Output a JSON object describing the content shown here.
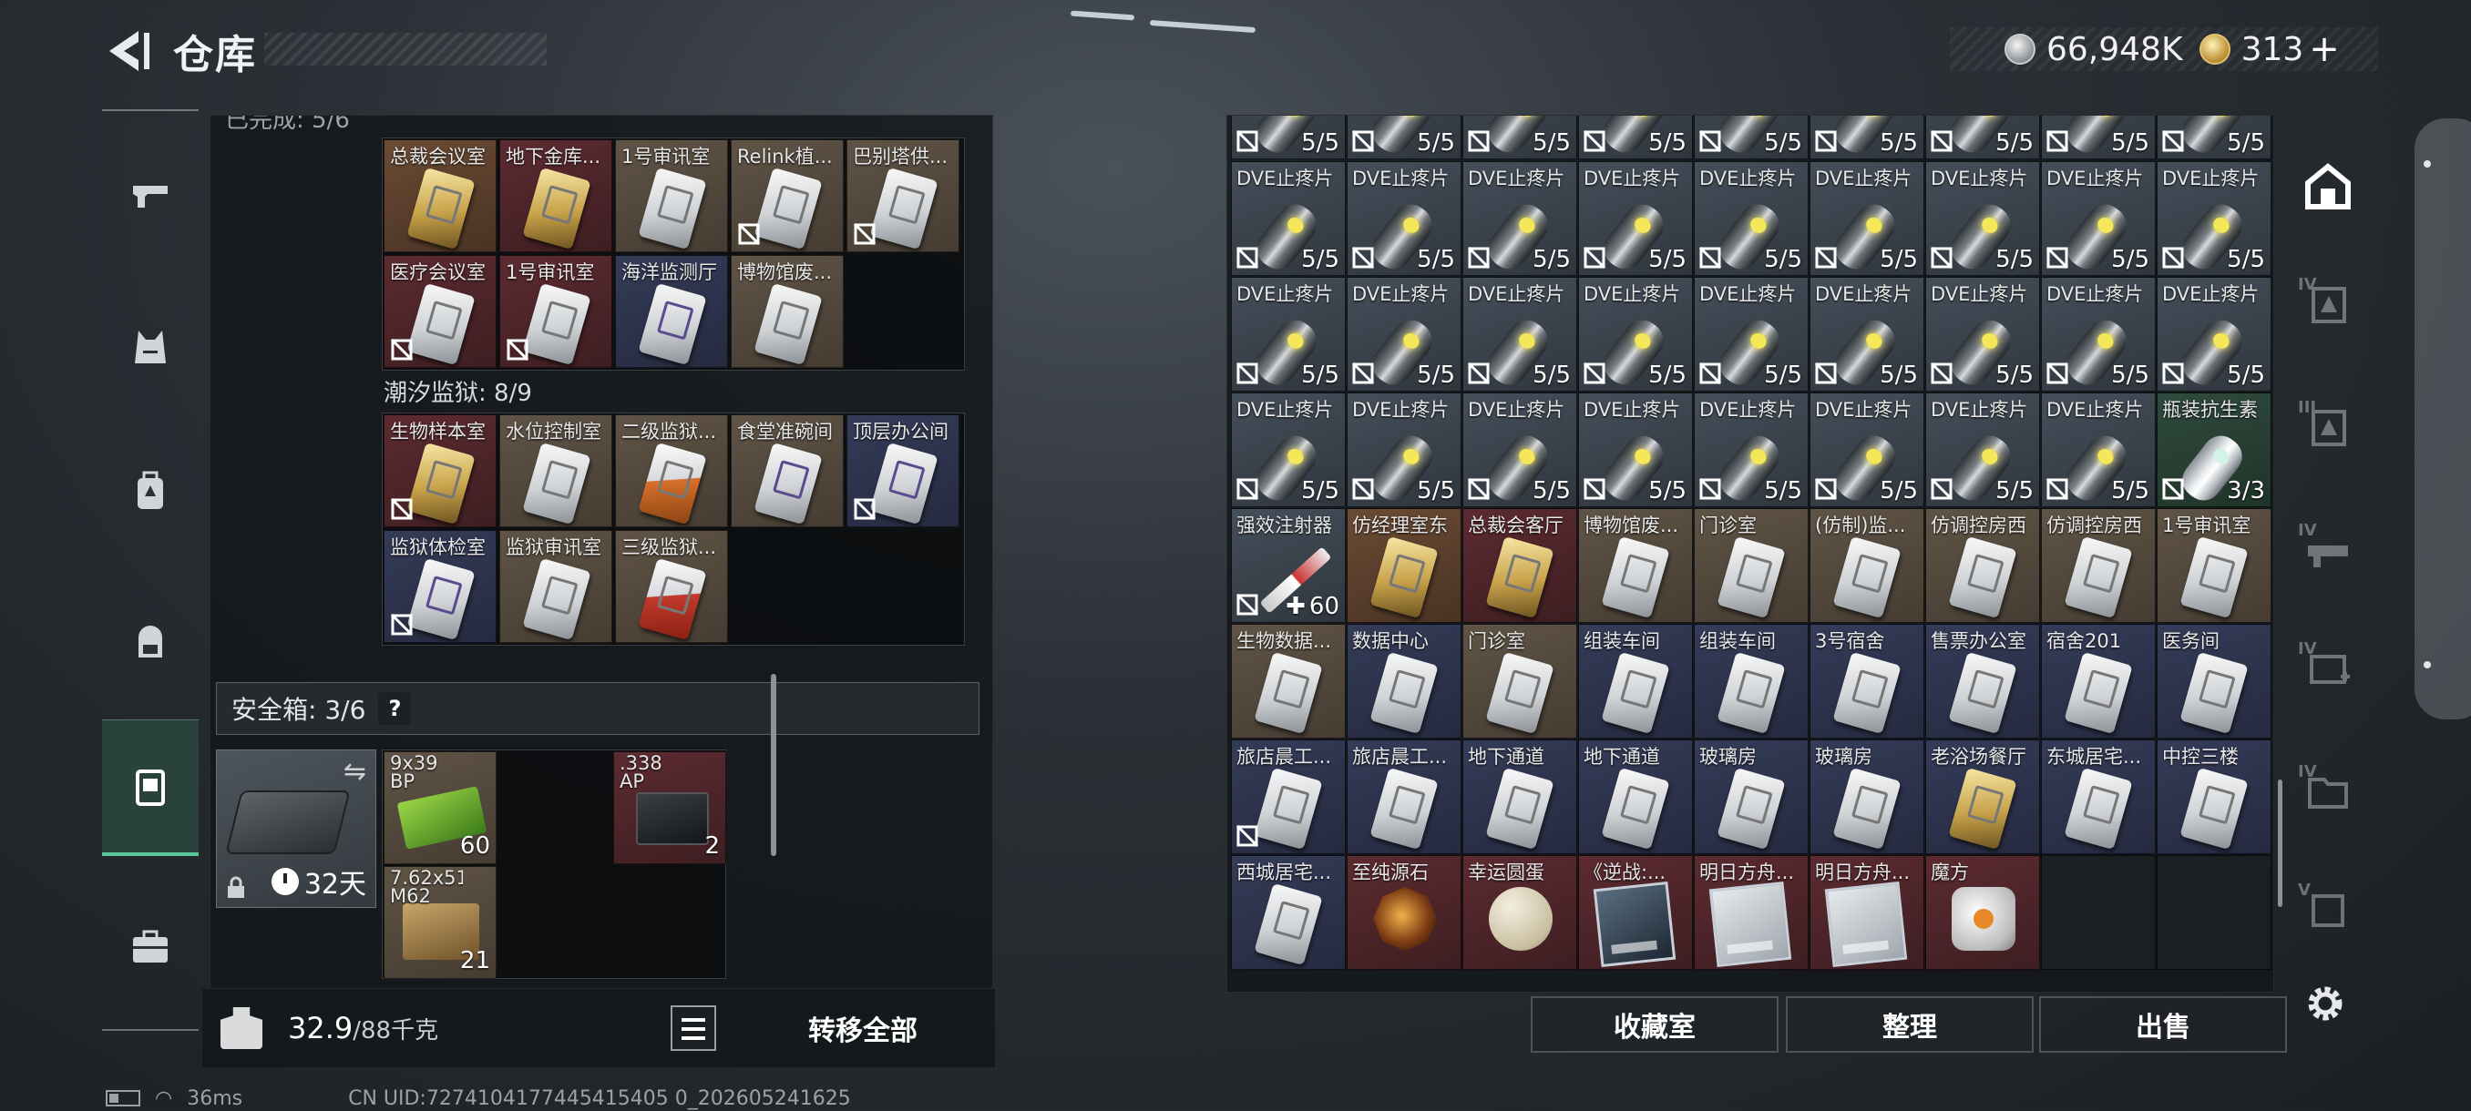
{
  "header": {
    "title": "仓库",
    "currency_silver": "66,948K",
    "currency_gold": "313",
    "plus": "+"
  },
  "left_panel": {
    "top_cut_label": "已完成: 5/6",
    "group1_cards": [
      {
        "name": "总裁会议室",
        "color": "gold",
        "card": "gold",
        "locked": false
      },
      {
        "name": "地下金库...",
        "color": "red",
        "card": "gold",
        "locked": false
      },
      {
        "name": "1号审讯室",
        "color": "brown",
        "card": "white",
        "locked": false
      },
      {
        "name": "Relink植...",
        "color": "brown",
        "card": "white",
        "locked": true
      },
      {
        "name": "巴别塔供...",
        "color": "brown",
        "card": "white",
        "locked": true
      },
      {
        "name": "医疗会议室",
        "color": "red",
        "card": "white",
        "locked": true
      },
      {
        "name": "1号审讯室",
        "color": "red",
        "card": "white",
        "locked": true
      },
      {
        "name": "海洋监测厅",
        "color": "blue",
        "card": "purple",
        "locked": false
      },
      {
        "name": "博物馆废...",
        "color": "brown",
        "card": "white",
        "locked": false
      }
    ],
    "prison_label": "潮汐监狱: 8/9",
    "group2_cards": [
      {
        "name": "生物样本室",
        "color": "red",
        "card": "gold",
        "locked": true
      },
      {
        "name": "水位控制室",
        "color": "brown",
        "card": "white",
        "locked": false
      },
      {
        "name": "二级监狱...",
        "color": "brown",
        "card": "orange",
        "locked": false
      },
      {
        "name": "食堂准碗间",
        "color": "brown",
        "card": "purple",
        "locked": false
      },
      {
        "name": "顶层办公间",
        "color": "blue",
        "card": "purple",
        "locked": true
      },
      {
        "name": "监狱体检室",
        "color": "blue",
        "card": "purple",
        "locked": true
      },
      {
        "name": "监狱审讯室",
        "color": "brown",
        "card": "white",
        "locked": false
      },
      {
        "name": "三级监狱...",
        "color": "brown",
        "card": "red",
        "locked": false
      }
    ],
    "safebox_label": "安全箱: 3/6",
    "help": "?",
    "safebox_days": "32天",
    "swap": "⇋",
    "ammo": [
      {
        "name": "9x39 BP",
        "qty": "60",
        "color": "brown"
      },
      {
        "name": ".338 AP",
        "qty": "2",
        "color": "red"
      },
      {
        "name": "7.62x51 M62",
        "qty": "21",
        "color": "brown"
      }
    ],
    "weight_current": "32.9",
    "weight_max": "/88千克",
    "transfer_all": "转移全部"
  },
  "inventory": {
    "pill_name": "DVE止疼片",
    "antibiotic_name": "瓶装抗生素",
    "injector_name": "强效注射器",
    "row0_qty": "5/5",
    "rows": [
      {
        "cells": [
          {
            "n": "",
            "q": "5/5",
            "k": "pill"
          },
          {
            "n": "",
            "q": "5/5",
            "k": "pill"
          },
          {
            "n": "",
            "q": "5/5",
            "k": "pill"
          },
          {
            "n": "",
            "q": "5/5",
            "k": "pill"
          },
          {
            "n": "",
            "q": "5/5",
            "k": "pill"
          },
          {
            "n": "",
            "q": "5/5",
            "k": "pill"
          },
          {
            "n": "",
            "q": "5/5",
            "k": "pill"
          },
          {
            "n": "",
            "q": "5/5",
            "k": "pill"
          },
          {
            "n": "",
            "q": "5/5",
            "k": "pill"
          }
        ]
      },
      {
        "cells": [
          {
            "n": "DVE止疼片",
            "q": "5/5",
            "k": "pill"
          },
          {
            "n": "DVE止疼片",
            "q": "5/5",
            "k": "pill"
          },
          {
            "n": "DVE止疼片",
            "q": "5/5",
            "k": "pill"
          },
          {
            "n": "DVE止疼片",
            "q": "5/5",
            "k": "pill"
          },
          {
            "n": "DVE止疼片",
            "q": "5/5",
            "k": "pill"
          },
          {
            "n": "DVE止疼片",
            "q": "5/5",
            "k": "pill"
          },
          {
            "n": "DVE止疼片",
            "q": "5/5",
            "k": "pill"
          },
          {
            "n": "DVE止疼片",
            "q": "5/5",
            "k": "pill"
          },
          {
            "n": "DVE止疼片",
            "q": "5/5",
            "k": "pill"
          }
        ]
      },
      {
        "cells": [
          {
            "n": "DVE止疼片",
            "q": "5/5",
            "k": "pill"
          },
          {
            "n": "DVE止疼片",
            "q": "5/5",
            "k": "pill"
          },
          {
            "n": "DVE止疼片",
            "q": "5/5",
            "k": "pill"
          },
          {
            "n": "DVE止疼片",
            "q": "5/5",
            "k": "pill"
          },
          {
            "n": "DVE止疼片",
            "q": "5/5",
            "k": "pill"
          },
          {
            "n": "DVE止疼片",
            "q": "5/5",
            "k": "pill"
          },
          {
            "n": "DVE止疼片",
            "q": "5/5",
            "k": "pill"
          },
          {
            "n": "DVE止疼片",
            "q": "5/5",
            "k": "pill"
          },
          {
            "n": "DVE止疼片",
            "q": "5/5",
            "k": "pill"
          }
        ]
      },
      {
        "cells": [
          {
            "n": "DVE止疼片",
            "q": "5/5",
            "k": "pill"
          },
          {
            "n": "DVE止疼片",
            "q": "5/5",
            "k": "pill"
          },
          {
            "n": "DVE止疼片",
            "q": "5/5",
            "k": "pill"
          },
          {
            "n": "DVE止疼片",
            "q": "5/5",
            "k": "pill"
          },
          {
            "n": "DVE止疼片",
            "q": "5/5",
            "k": "pill"
          },
          {
            "n": "DVE止疼片",
            "q": "5/5",
            "k": "pill"
          },
          {
            "n": "DVE止疼片",
            "q": "5/5",
            "k": "pill"
          },
          {
            "n": "DVE止疼片",
            "q": "5/5",
            "k": "pill"
          },
          {
            "n": "瓶装抗生素",
            "q": "3/3",
            "k": "pill-white",
            "bg": "green"
          }
        ]
      },
      {
        "cells": [
          {
            "n": "强效注射器",
            "q": "60",
            "k": "syringe",
            "bg": "pill",
            "plus": true
          },
          {
            "n": "仿经理室东",
            "q": "",
            "k": "card-gold",
            "bg": "gold"
          },
          {
            "n": "总裁会客厅",
            "q": "",
            "k": "card-gold",
            "bg": "red"
          },
          {
            "n": "博物馆废...",
            "q": "",
            "k": "card-white",
            "bg": "brown"
          },
          {
            "n": "门诊室",
            "q": "",
            "k": "card-white",
            "bg": "brown"
          },
          {
            "n": "(仿制)监...",
            "q": "",
            "k": "card-white",
            "bg": "brown"
          },
          {
            "n": "仿调控房西",
            "q": "",
            "k": "card-white",
            "bg": "brown"
          },
          {
            "n": "仿调控房西",
            "q": "",
            "k": "card-white",
            "bg": "brown"
          },
          {
            "n": "1号审讯室",
            "q": "",
            "k": "card-white",
            "bg": "brown"
          }
        ]
      },
      {
        "cells": [
          {
            "n": "生物数据...",
            "q": "",
            "k": "card-white",
            "bg": "brown"
          },
          {
            "n": "数据中心",
            "q": "",
            "k": "card-white",
            "bg": "blue"
          },
          {
            "n": "门诊室",
            "q": "",
            "k": "card-white",
            "bg": "brown"
          },
          {
            "n": "组装车间",
            "q": "",
            "k": "card-white",
            "bg": "blue"
          },
          {
            "n": "组装车间",
            "q": "",
            "k": "card-white",
            "bg": "blue"
          },
          {
            "n": "3号宿舍",
            "q": "",
            "k": "card-white",
            "bg": "blue"
          },
          {
            "n": "售票办公室",
            "q": "",
            "k": "card-white",
            "bg": "blue"
          },
          {
            "n": "宿舍201",
            "q": "",
            "k": "card-white",
            "bg": "blue"
          },
          {
            "n": "医务间",
            "q": "",
            "k": "card-white",
            "bg": "blue"
          }
        ]
      },
      {
        "cells": [
          {
            "n": "旅店晨工...",
            "q": "",
            "k": "card-white",
            "bg": "blue",
            "lock": true
          },
          {
            "n": "旅店晨工...",
            "q": "",
            "k": "card-white",
            "bg": "blue"
          },
          {
            "n": "地下通道",
            "q": "",
            "k": "card-white",
            "bg": "blue"
          },
          {
            "n": "地下通道",
            "q": "",
            "k": "card-white",
            "bg": "blue"
          },
          {
            "n": "玻璃房",
            "q": "",
            "k": "card-white",
            "bg": "blue"
          },
          {
            "n": "玻璃房",
            "q": "",
            "k": "card-white",
            "bg": "blue"
          },
          {
            "n": "老浴场餐厅",
            "q": "",
            "k": "card-gold",
            "bg": "blue"
          },
          {
            "n": "东城居宅...",
            "q": "",
            "k": "card-white",
            "bg": "blue"
          },
          {
            "n": "中控三楼",
            "q": "",
            "k": "card-white",
            "bg": "blue"
          }
        ]
      },
      {
        "cells": [
          {
            "n": "西城居宅...",
            "q": "",
            "k": "card-white",
            "bg": "blue"
          },
          {
            "n": "至纯源石",
            "q": "",
            "k": "orb-amber",
            "bg": "red"
          },
          {
            "n": "幸运圆蛋",
            "q": "",
            "k": "orb-egg",
            "bg": "red"
          },
          {
            "n": "《逆战:...",
            "q": "",
            "k": "disc",
            "bg": "red"
          },
          {
            "n": "明日方舟...",
            "q": "",
            "k": "disc-light",
            "bg": "red"
          },
          {
            "n": "明日方舟...",
            "q": "",
            "k": "disc-light",
            "bg": "red"
          },
          {
            "n": "魔方",
            "q": "",
            "k": "orb-cube",
            "bg": "red"
          },
          {
            "n": "",
            "q": "",
            "k": "empty",
            "bg": "empty"
          },
          {
            "n": "",
            "q": "",
            "k": "empty",
            "bg": "empty"
          }
        ]
      }
    ]
  },
  "actions": {
    "collection": "收藏室",
    "sort": "整理",
    "sell": "出售"
  },
  "category_roman": [
    "IV",
    "III",
    "IV",
    "IV",
    "IV",
    "V"
  ],
  "status_bar": {
    "ping": "36ms",
    "uid": "CN UID:7274104177445415405 0_202605241625"
  },
  "colors": {
    "accent_green": "#58c79b",
    "card_gold": "#6b4b34",
    "card_red": "#5c2b30",
    "card_blue": "#353c58",
    "card_brown": "#5f5446"
  }
}
